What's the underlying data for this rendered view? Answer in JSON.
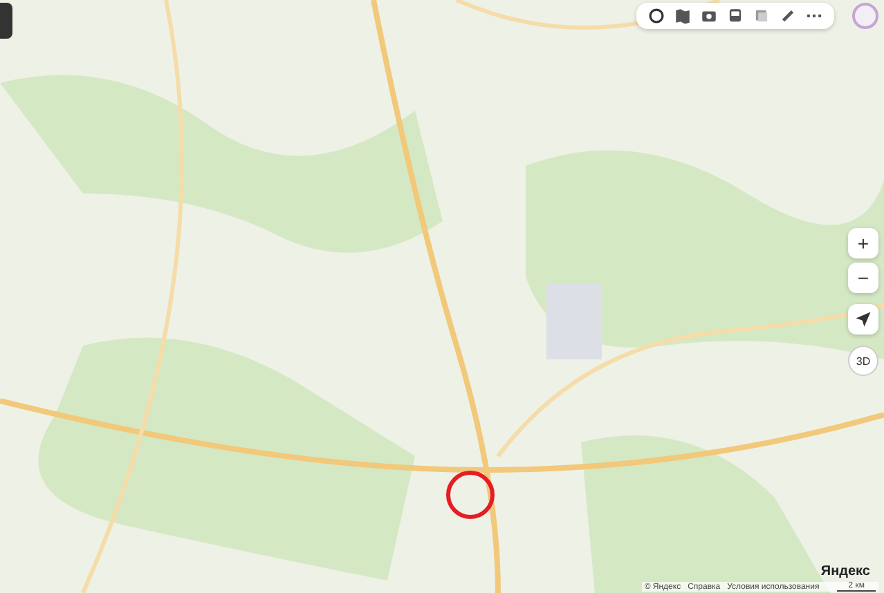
{
  "zoom": {
    "plus": "+",
    "minus": "−"
  },
  "view_3d": "3D",
  "logo": "Яндекс",
  "footer": {
    "links": [
      "© Яндекс",
      "Справка",
      "Условия использования"
    ],
    "scale": "2 км"
  }
}
